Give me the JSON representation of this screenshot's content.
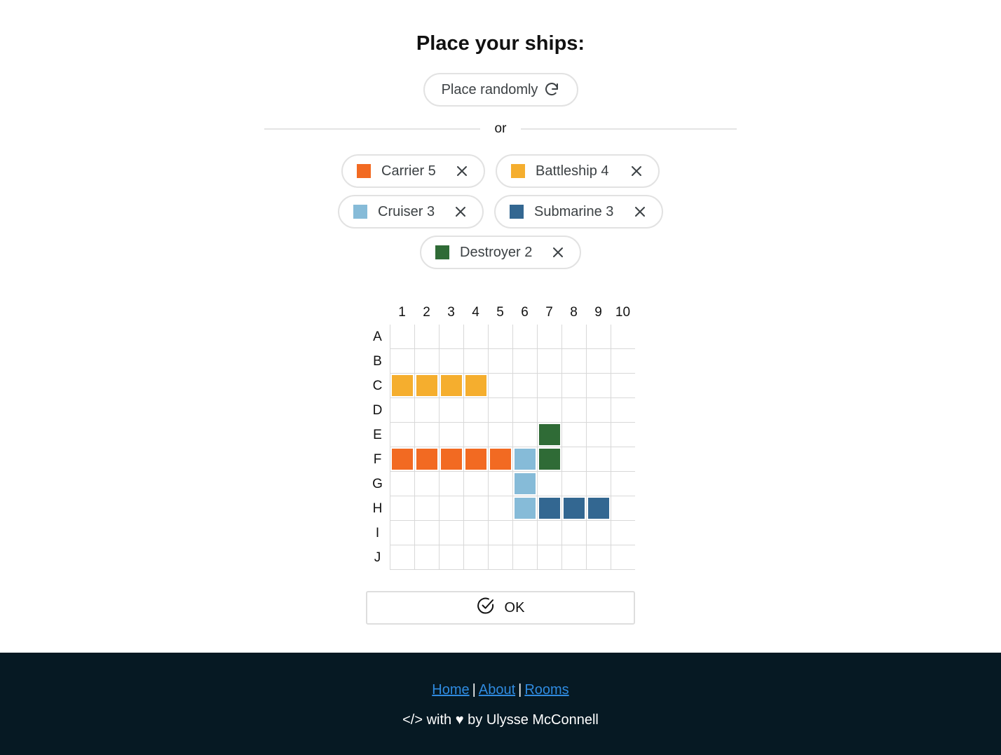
{
  "page": {
    "title": "Place your ships:",
    "random_button_label": "Place randomly",
    "divider_text": "or",
    "ok_button_label": "OK"
  },
  "ships": [
    {
      "name": "Carrier",
      "size": "5",
      "label": "Carrier 5",
      "color": "#f26a22",
      "cells": [
        "F1",
        "F2",
        "F3",
        "F4",
        "F5"
      ]
    },
    {
      "name": "Battleship",
      "size": "4",
      "label": "Battleship 4",
      "color": "#f5ae2e",
      "cells": [
        "C1",
        "C2",
        "C3",
        "C4"
      ]
    },
    {
      "name": "Cruiser",
      "size": "3",
      "label": "Cruiser 3",
      "color": "#86bbd8",
      "cells": [
        "F6",
        "G6",
        "H6"
      ]
    },
    {
      "name": "Submarine",
      "size": "3",
      "label": "Submarine 3",
      "color": "#336791",
      "cells": [
        "H7",
        "H8",
        "H9"
      ]
    },
    {
      "name": "Destroyer",
      "size": "2",
      "label": "Destroyer 2",
      "color": "#2f6b36",
      "cells": [
        "E7",
        "F7"
      ]
    }
  ],
  "board": {
    "column_labels": [
      "1",
      "2",
      "3",
      "4",
      "5",
      "6",
      "7",
      "8",
      "9",
      "10"
    ],
    "row_labels": [
      "A",
      "B",
      "C",
      "D",
      "E",
      "F",
      "G",
      "H",
      "I",
      "J"
    ]
  },
  "footer": {
    "links": [
      "Home",
      "About",
      "Rooms"
    ],
    "separator": "|",
    "credit": "</> with ♥ by Ulysse McConnell"
  }
}
